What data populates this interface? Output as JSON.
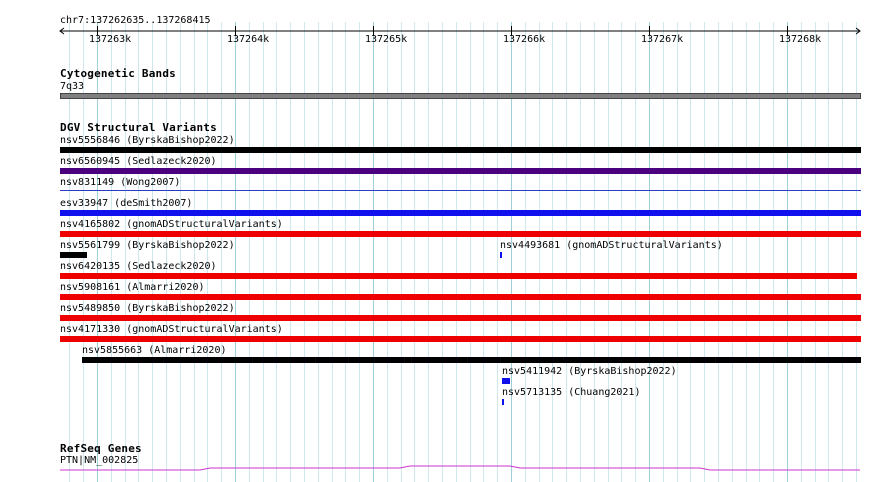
{
  "ruler": {
    "location": "chr7:137262635..137268415",
    "ticks": [
      "137263k",
      "137264k",
      "137265k",
      "137266k",
      "137267k",
      "137268k"
    ]
  },
  "cytoband": {
    "title": "Cytogenetic Bands",
    "band": "7q33",
    "color": "#808080"
  },
  "dgv": {
    "title": "DGV Structural Variants",
    "features": [
      {
        "label": "nsv5556846 (ByrskaBishop2022)",
        "color": "#000000"
      },
      {
        "label": "nsv6560945 (Sedlazeck2020)",
        "color": "#4b0080"
      },
      {
        "label": "nsv831149 (Wong2007)",
        "color": "#2b3cc4"
      },
      {
        "label": "esv33947 (deSmith2007)",
        "color": "#1010ee"
      },
      {
        "label": "nsv4165802 (gnomADStructuralVariants)",
        "color": "#ee0000"
      },
      {
        "label": "nsv5561799 (ByrskaBishop2022)",
        "color": "#000000"
      },
      {
        "label": "nsv4493681 (gnomADStructuralVariants)",
        "color": "#1010ee"
      },
      {
        "label": "nsv6420135 (Sedlazeck2020)",
        "color": "#ee0000"
      },
      {
        "label": "nsv5908161 (Almarri2020)",
        "color": "#ee0000"
      },
      {
        "label": "nsv5489850 (ByrskaBishop2022)",
        "color": "#ee0000"
      },
      {
        "label": "nsv4171330 (gnomADStructuralVariants)",
        "color": "#ee0000"
      },
      {
        "label": "nsv5855663 (Almarri2020)",
        "color": "#000000"
      },
      {
        "label": "nsv5411942 (ByrskaBishop2022)",
        "color": "#1010ee"
      },
      {
        "label": "nsv5713135 (Chuang2021)",
        "color": "#1010ee"
      }
    ]
  },
  "refseq": {
    "title": "RefSeq Genes",
    "gene": "PTN|NM_002825",
    "color": "#cc33cc"
  }
}
